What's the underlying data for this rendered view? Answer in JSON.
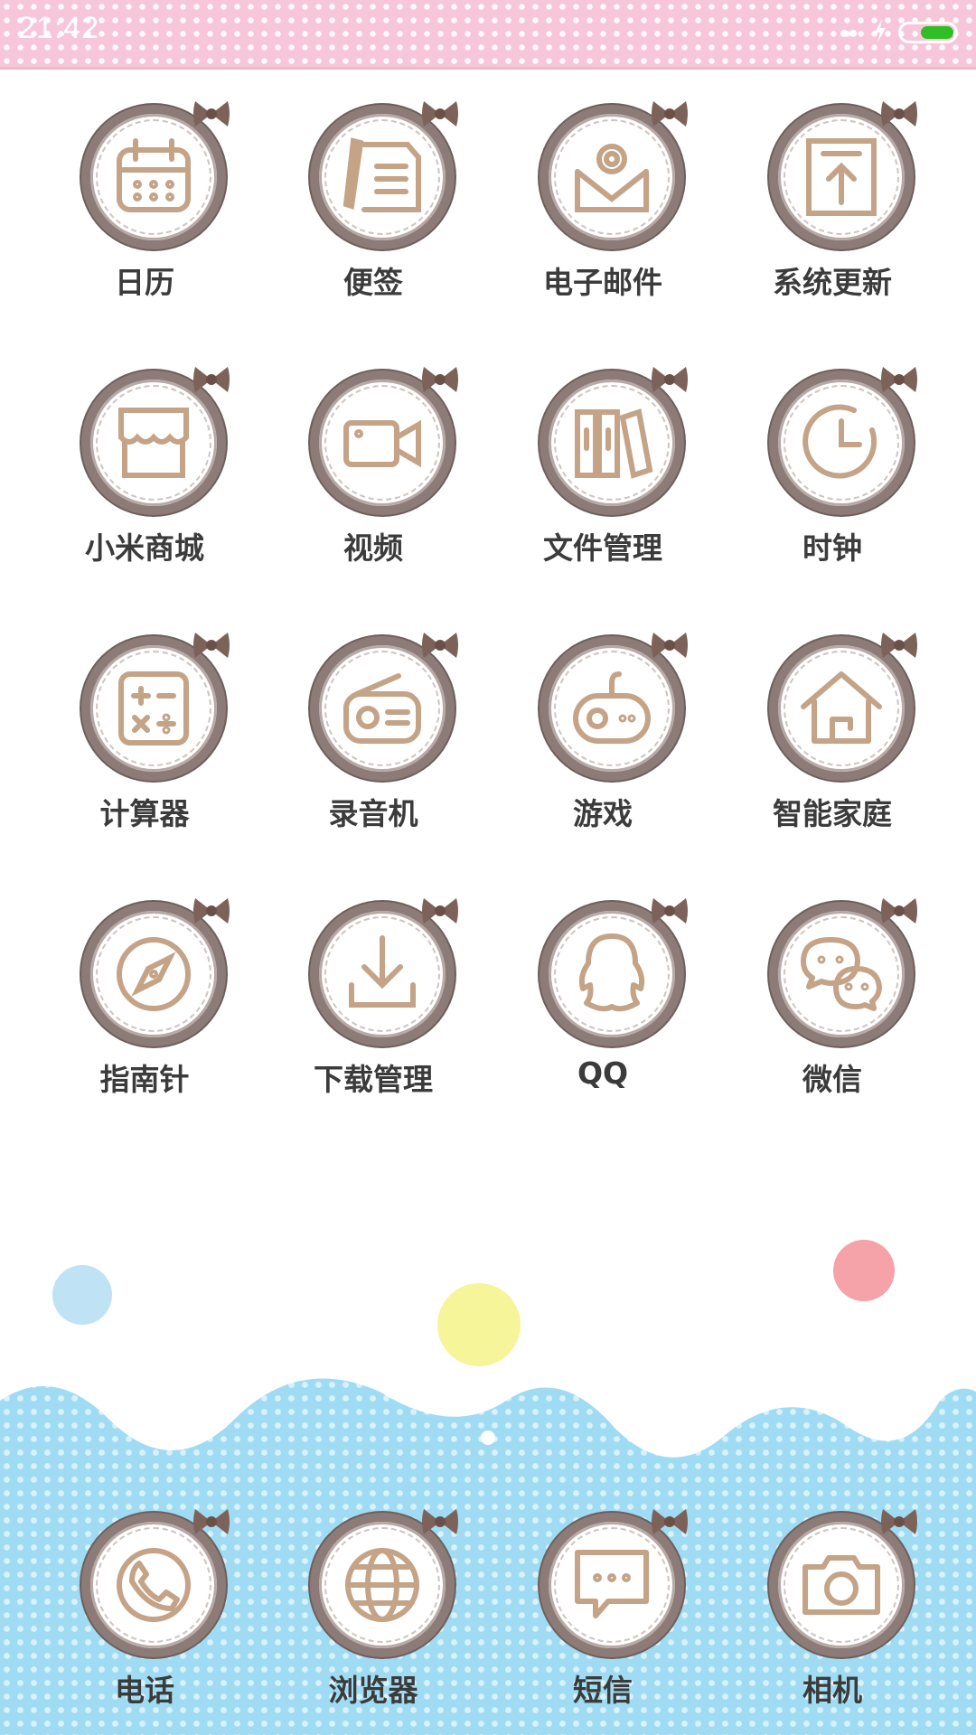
{
  "status_bar": {
    "time": "21:42",
    "battery_color": "#2fbf24"
  },
  "apps": [
    {
      "label": "日历",
      "icon": "calendar-icon"
    },
    {
      "label": "便签",
      "icon": "notes-icon"
    },
    {
      "label": "电子邮件",
      "icon": "email-icon"
    },
    {
      "label": "系统更新",
      "icon": "system-update-icon"
    },
    {
      "label": "小米商城",
      "icon": "mi-store-icon"
    },
    {
      "label": "视频",
      "icon": "video-icon"
    },
    {
      "label": "文件管理",
      "icon": "file-manager-icon"
    },
    {
      "label": "时钟",
      "icon": "clock-icon"
    },
    {
      "label": "计算器",
      "icon": "calculator-icon"
    },
    {
      "label": "录音机",
      "icon": "recorder-icon"
    },
    {
      "label": "游戏",
      "icon": "game-icon"
    },
    {
      "label": "智能家庭",
      "icon": "smart-home-icon"
    },
    {
      "label": "指南针",
      "icon": "compass-icon"
    },
    {
      "label": "下载管理",
      "icon": "download-icon"
    },
    {
      "label": "QQ",
      "icon": "qq-icon"
    },
    {
      "label": "微信",
      "icon": "wechat-icon"
    }
  ],
  "dock": [
    {
      "label": "电话",
      "icon": "phone-icon"
    },
    {
      "label": "浏览器",
      "icon": "browser-icon"
    },
    {
      "label": "短信",
      "icon": "messages-icon"
    },
    {
      "label": "相机",
      "icon": "camera-icon"
    }
  ],
  "colors": {
    "icon_stroke": "#c4a387",
    "ring": "#8c7b77",
    "bow": "#7d625a",
    "cloud": "#9fdcf3"
  }
}
